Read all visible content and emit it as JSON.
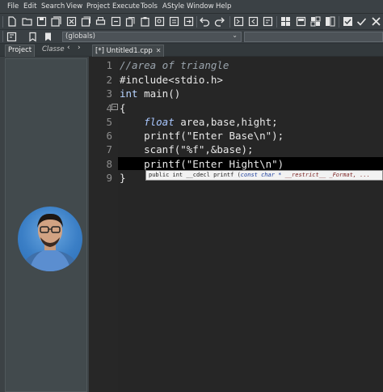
{
  "menu": [
    "File",
    "Edit",
    "Search",
    "View",
    "Project",
    "Execute",
    "Tools",
    "AStyle",
    "Window",
    "Help"
  ],
  "toolbar2": {
    "scope_value": "(globals)"
  },
  "left_panel": {
    "tab_project": "Project",
    "tab_classes": "Classe"
  },
  "editor_tab": {
    "label": "[*] Untitled1.cpp"
  },
  "code_lines": [
    {
      "n": "1",
      "parts": [
        {
          "cls": "cm",
          "t": "//area of triangle"
        }
      ]
    },
    {
      "n": "2",
      "parts": [
        {
          "cls": "",
          "t": "#include<stdio.h>"
        }
      ]
    },
    {
      "n": "3",
      "parts": [
        {
          "cls": "kwn",
          "t": "int"
        },
        {
          "cls": "",
          "t": " main()"
        }
      ]
    },
    {
      "n": "4",
      "parts": [
        {
          "cls": "",
          "t": "{"
        }
      ]
    },
    {
      "n": "5",
      "parts": [
        {
          "cls": "",
          "t": "    "
        },
        {
          "cls": "kw",
          "t": "float"
        },
        {
          "cls": "",
          "t": " area,base,hight;"
        }
      ]
    },
    {
      "n": "6",
      "parts": [
        {
          "cls": "",
          "t": "    printf(\"Enter Base\\n\");"
        }
      ]
    },
    {
      "n": "7",
      "parts": [
        {
          "cls": "",
          "t": "    scanf(\"%f\",&base);"
        }
      ]
    },
    {
      "n": "8",
      "parts": [
        {
          "cls": "",
          "t": "    printf(\"Enter Hight\\n\")"
        }
      ]
    },
    {
      "n": "9",
      "parts": [
        {
          "cls": "",
          "t": "}"
        }
      ]
    }
  ],
  "tooltip": {
    "p1": "public int __cdecl printf (",
    "p2": "const char *",
    "p3": " __restrict__ _Format, ..."
  },
  "colors": {
    "editor_bg": "#262626",
    "panel_bg": "#3c4245",
    "comment": "#9aa4ad",
    "keyword": "#a9c7ff"
  }
}
